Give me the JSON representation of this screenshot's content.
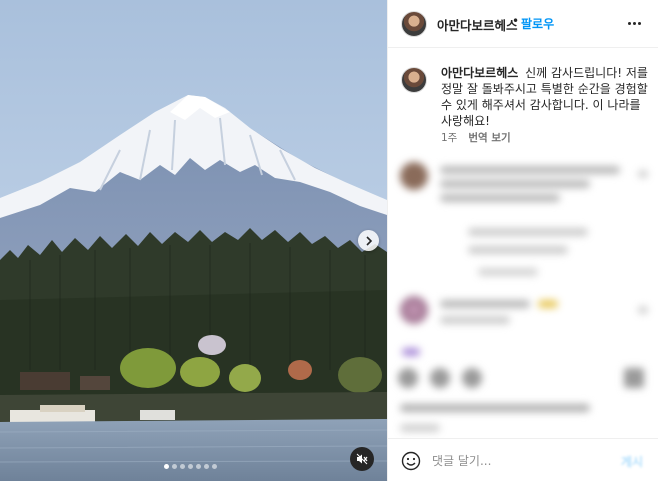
{
  "post": {
    "username": "아만다보르헤스",
    "separator": "•",
    "follow_label": "팔로우"
  },
  "caption": {
    "username": "아만다보르헤스",
    "text": "신께 감사드립니다! 저를 정말 잘 돌봐주시고 특별한 순간을 경험할 수 있게 해주셔서 감사합니다. 이 나라를 사랑해요!",
    "time": "1주",
    "translate_label": "번역 보기"
  },
  "media": {
    "slide_count": 7,
    "active_slide": 1
  },
  "comment_bar": {
    "placeholder": "댓글 달기...",
    "post_label": "게시"
  },
  "colors": {
    "accent": "#0095f6",
    "text": "#262626",
    "muted": "#737373"
  }
}
